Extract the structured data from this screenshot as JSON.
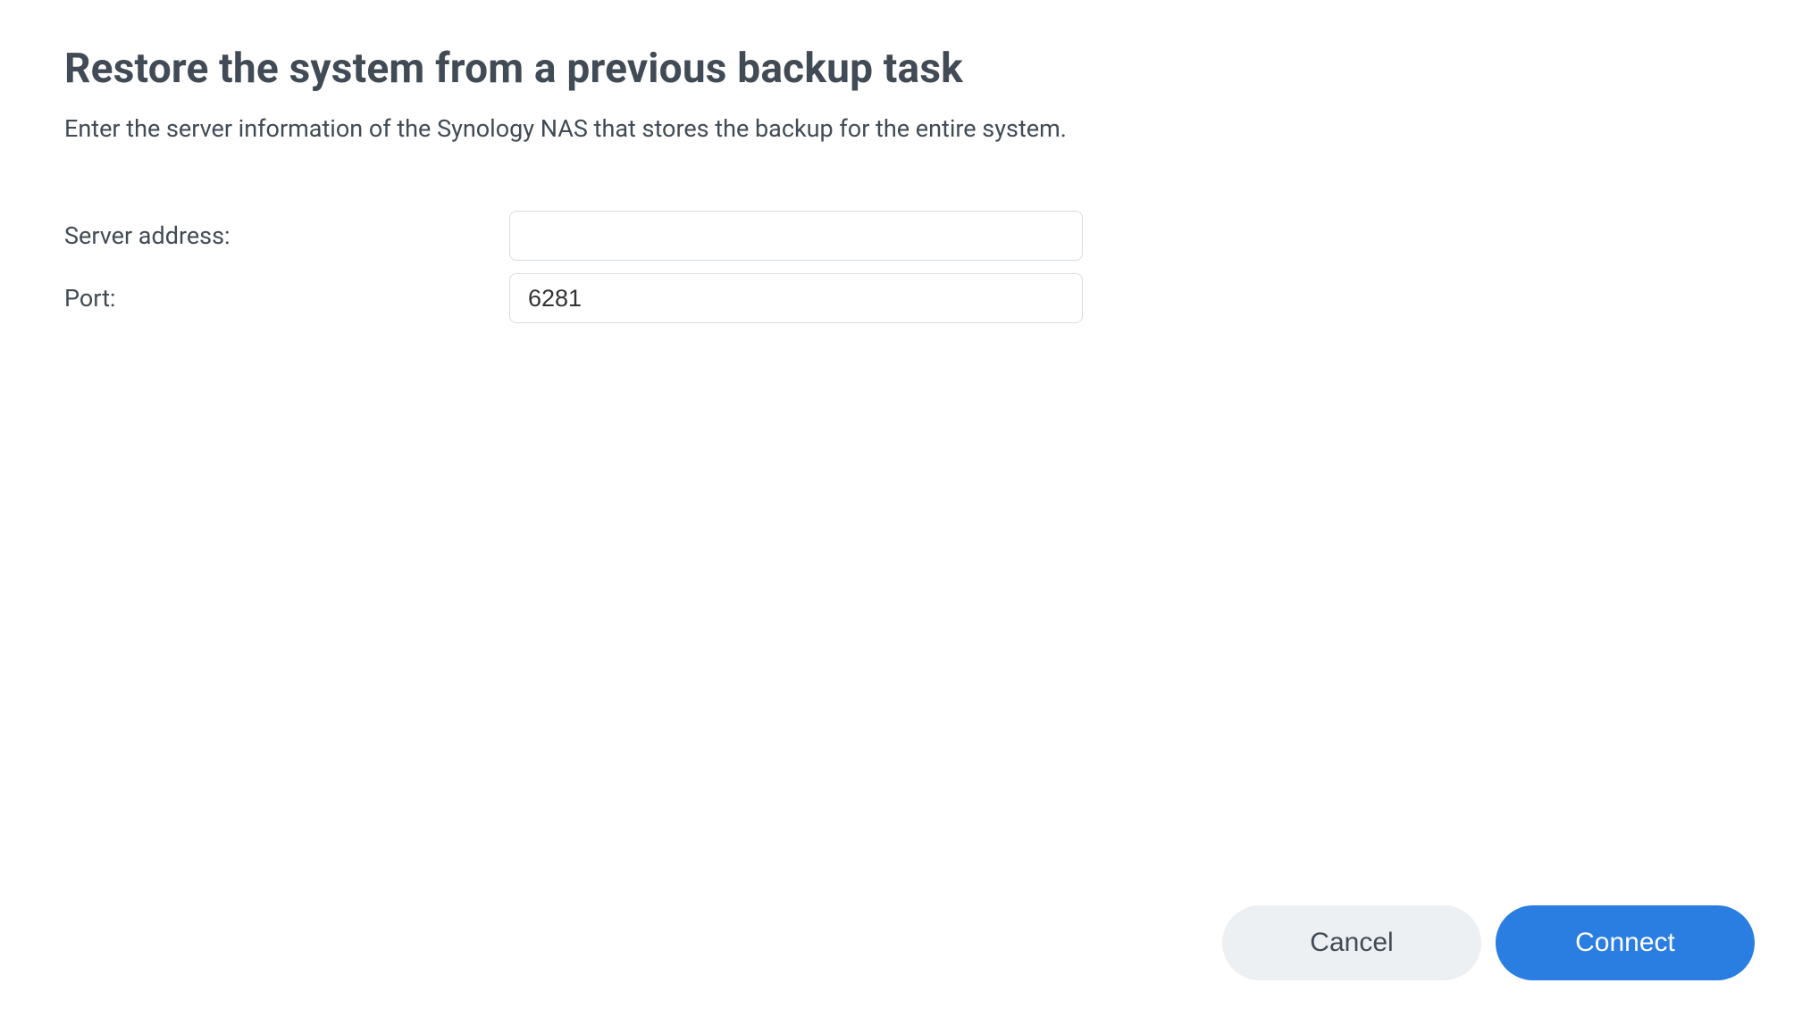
{
  "header": {
    "title": "Restore the system from a previous backup task",
    "description": "Enter the server information of the Synology NAS that stores the backup for the entire system."
  },
  "form": {
    "server_address": {
      "label": "Server address:",
      "value": ""
    },
    "port": {
      "label": "Port:",
      "value": "6281"
    }
  },
  "footer": {
    "cancel_label": "Cancel",
    "connect_label": "Connect"
  }
}
